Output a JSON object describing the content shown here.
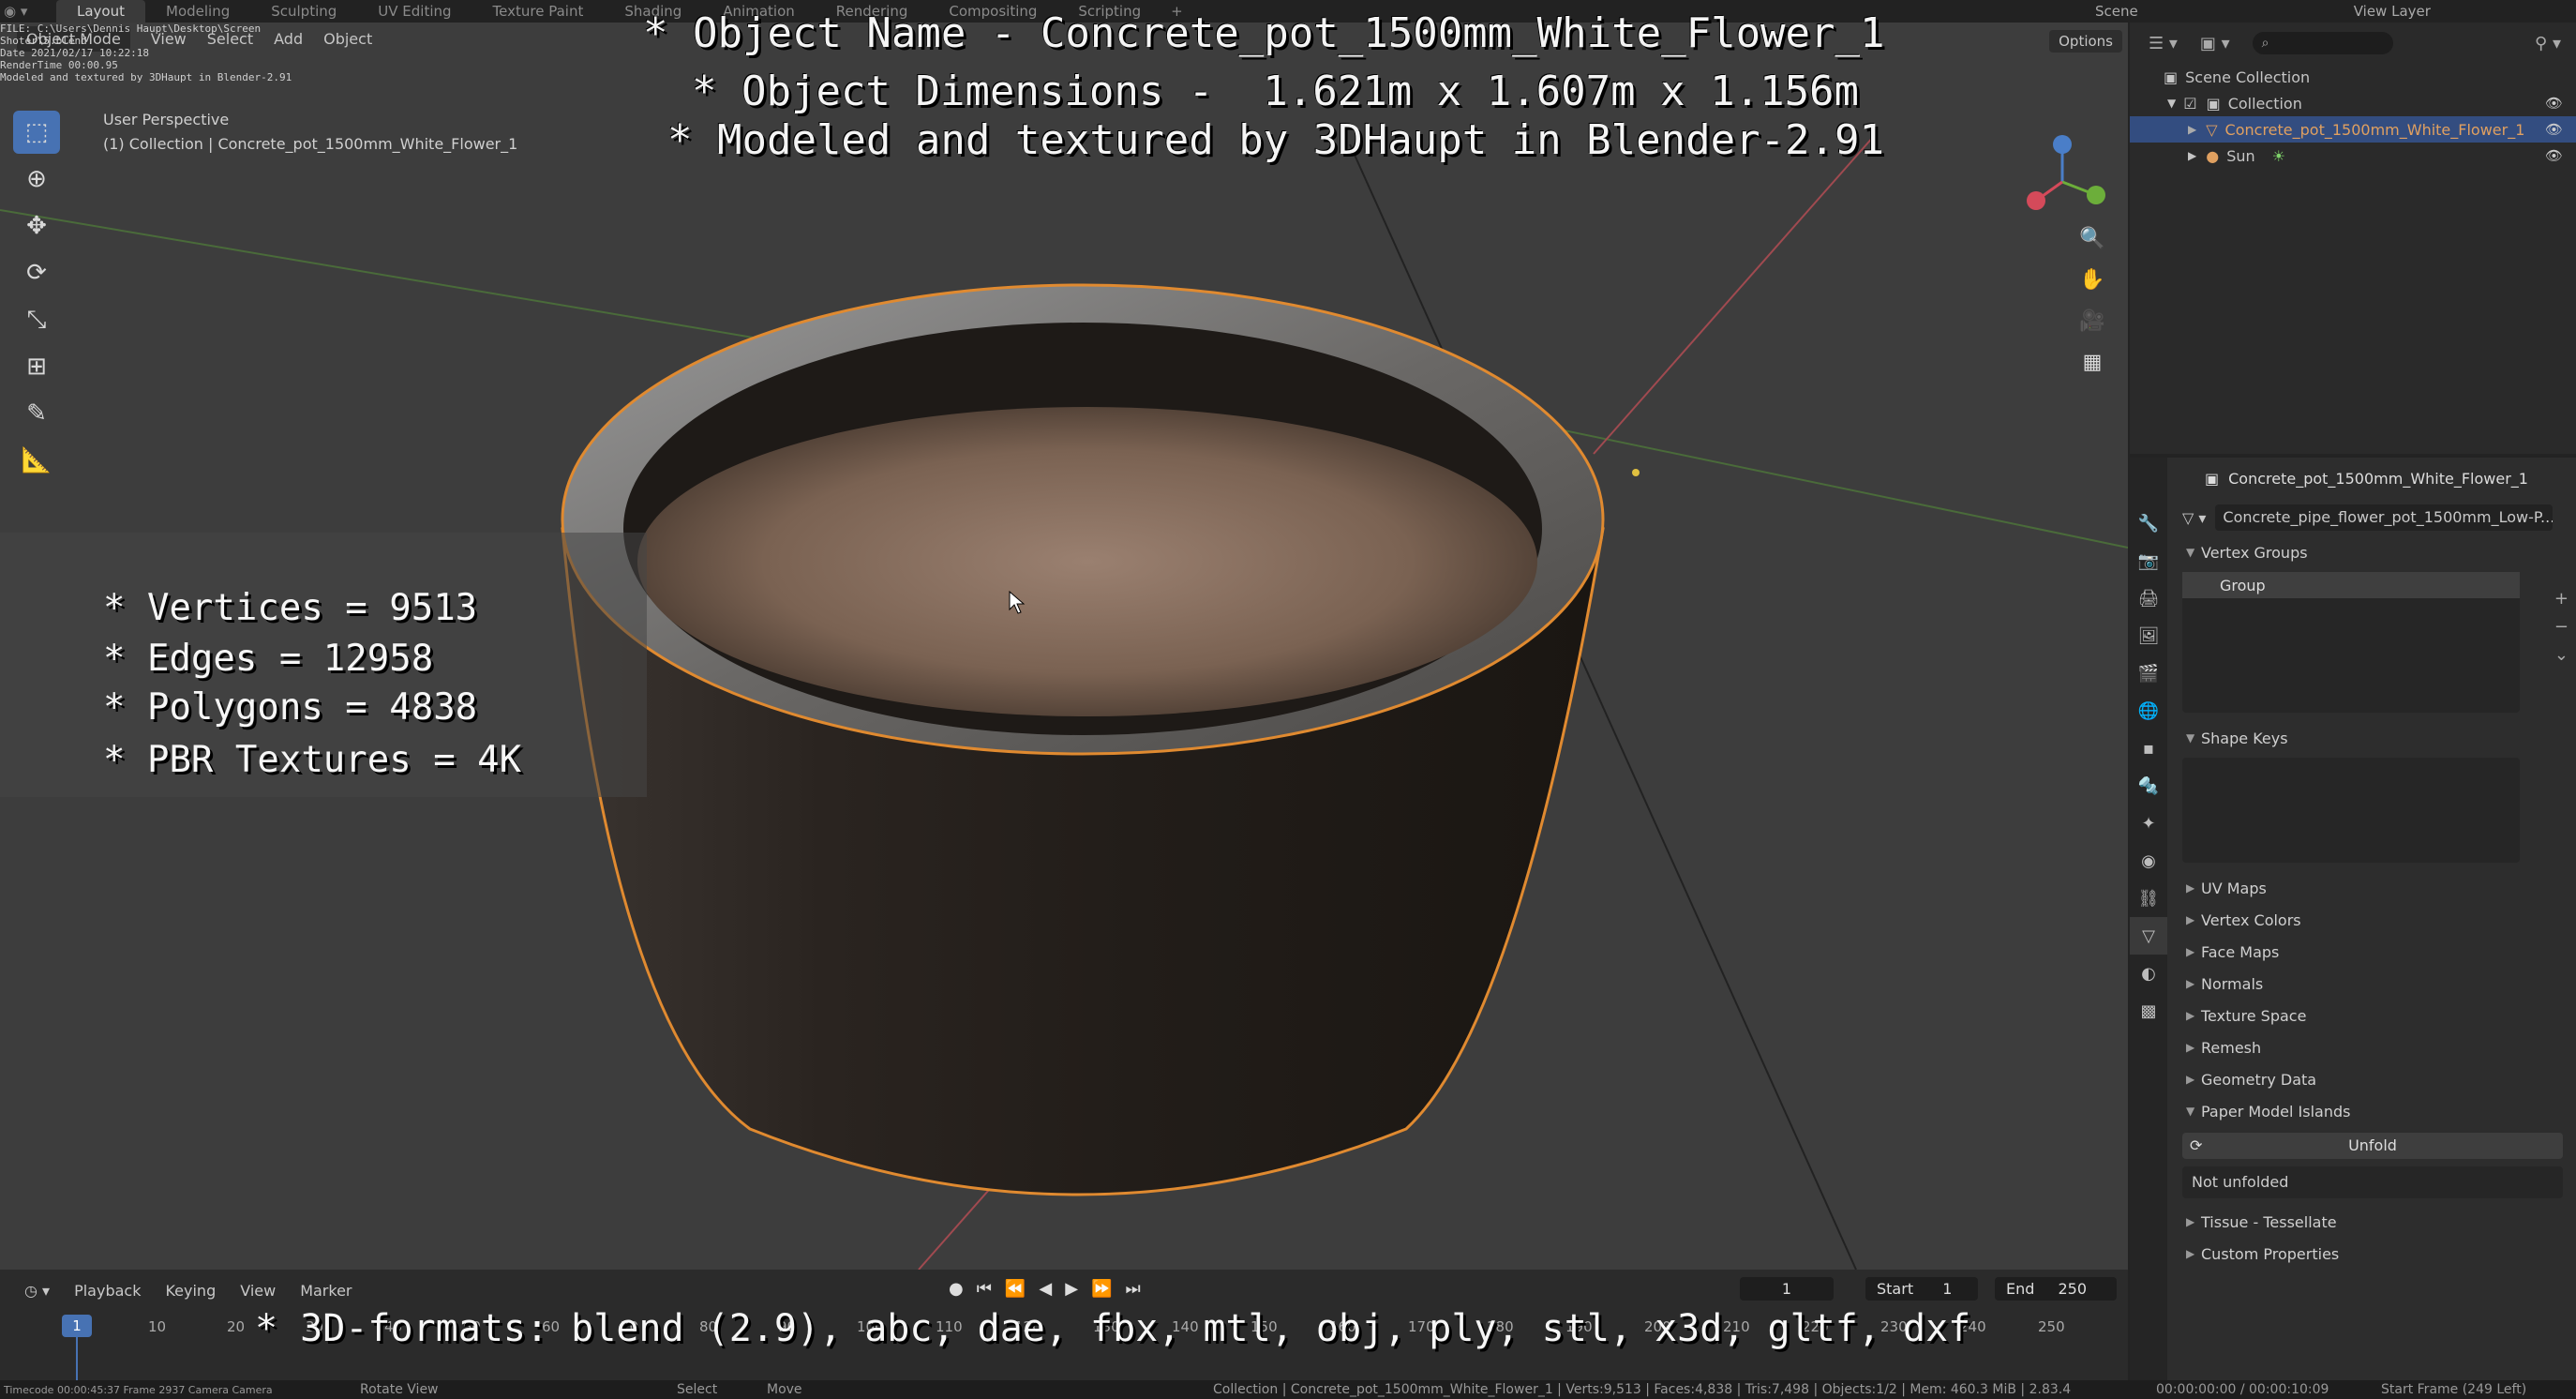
{
  "app": {
    "title_bar": "FILE: C:\\Users\\Dennis Haupt\\Desktop\\Screen Shoter\\5.blend",
    "tabs": [
      "Layout",
      "Modeling",
      "Sculpting",
      "UV Editing",
      "Texture Paint",
      "Shading",
      "Animation",
      "Rendering",
      "Compositing",
      "Scripting"
    ],
    "active_tab": "Layout",
    "scene_label": "Scene",
    "view_layer_label": "View Layer",
    "tiny_info": [
      "Date 2021/02/17 10:22:18",
      "RenderTime 00:00.95",
      "Modeled and textured by 3DHaupt in Blender-2.91"
    ]
  },
  "viewport": {
    "mode": "Object Mode",
    "menu": [
      "View",
      "Select",
      "Add",
      "Object"
    ],
    "options_label": "Options",
    "perspective": "User Perspective",
    "collection_line": "(1) Collection | Concrete_pot_1500mm_White_Flower_1",
    "overlay_title": [
      "* Object Name - Concrete_pot_1500mm_White_Flower_1",
      "* Object Dimensions -  1.621m x 1.607m x 1.156m",
      "* Modeled and textured by 3DHaupt in Blender-2.91"
    ],
    "stats": [
      "* Vertices = 9513",
      "* Edges = 12958",
      "* Polygons = 4838",
      "* PBR Textures = 4K"
    ]
  },
  "timeline": {
    "menu": [
      "Playback",
      "Keying",
      "View",
      "Marker"
    ],
    "current_frame": "1",
    "start_label": "Start",
    "start": "1",
    "end_label": "End",
    "end": "250",
    "ruler": [
      "1",
      "10",
      "20",
      "30",
      "40",
      "50",
      "60",
      "70",
      "80",
      "90",
      "100",
      "110",
      "120",
      "130",
      "140",
      "150",
      "160",
      "170",
      "180",
      "190",
      "200",
      "210",
      "220",
      "230",
      "240",
      "250"
    ],
    "formats_text": "* 3D-formats: blend (2.9), abc, dae, fbx, mtl, obj, ply, stl, x3d, gltf, dxf"
  },
  "statusbar": {
    "left": "Timecode 00:00:45:37  Frame 2937  Camera Camera",
    "rotate": "Rotate View",
    "select": "Select",
    "move": "Move",
    "stats": "Collection | Concrete_pot_1500mm_White_Flower_1 | Verts:9,513 | Faces:4,838 | Tris:7,498 | Objects:1/2 | Mem: 460.3 MiB | 2.83.4",
    "time": "00:00:00:00 / 00:00:10:09",
    "start_frame": "Start Frame (249 Left)"
  },
  "outliner": {
    "search_placeholder": "",
    "scene_collection": "Scene Collection",
    "collection": "Collection",
    "object": "Concrete_pot_1500mm_White_Flower_1",
    "sun": "Sun"
  },
  "properties": {
    "object_name": "Concrete_pot_1500mm_White_Flower_1",
    "mesh_name": "Concrete_pipe_flower_pot_1500mm_Low-P...",
    "vertex_groups": "Vertex Groups",
    "group_item": "Group",
    "shape_keys": "Shape Keys",
    "panels": [
      "UV Maps",
      "Vertex Colors",
      "Face Maps",
      "Normals",
      "Texture Space",
      "Remesh",
      "Geometry Data"
    ],
    "paper_model": "Paper Model Islands",
    "unfold": "Unfold",
    "not_unfolded": "Not unfolded",
    "tissue": "Tissue - Tessellate",
    "custom_props": "Custom Properties"
  },
  "colors": {
    "accent": "#4772b3",
    "selection": "#e08a30",
    "header": "#2b2b2b"
  }
}
